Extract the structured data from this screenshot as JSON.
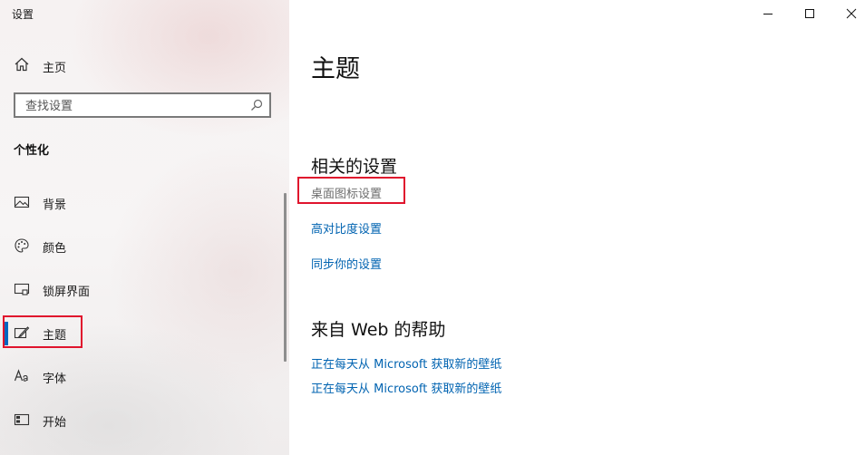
{
  "window": {
    "title": "设置",
    "minimize_icon": "minimize-icon",
    "maximize_icon": "maximize-icon",
    "close_icon": "close-icon"
  },
  "sidebar": {
    "home": {
      "label": "主页",
      "icon": "home-icon"
    },
    "search": {
      "placeholder": "查找设置",
      "value": "",
      "icon": "search-icon"
    },
    "section_title": "个性化",
    "items": [
      {
        "label": "背景",
        "icon": "picture-icon",
        "selected": false
      },
      {
        "label": "颜色",
        "icon": "palette-icon",
        "selected": false
      },
      {
        "label": "锁屏界面",
        "icon": "lock-screen-icon",
        "selected": false
      },
      {
        "label": "主题",
        "icon": "theme-brush-icon",
        "selected": true
      },
      {
        "label": "字体",
        "icon": "font-icon",
        "selected": false
      },
      {
        "label": "开始",
        "icon": "start-icon",
        "selected": false
      }
    ]
  },
  "main": {
    "title": "主题",
    "related_settings": {
      "title": "相关的设置",
      "links": [
        {
          "label": "桌面图标设置",
          "state": "disabled"
        },
        {
          "label": "高对比度设置",
          "state": "normal"
        },
        {
          "label": "同步你的设置",
          "state": "normal"
        }
      ]
    },
    "web_help": {
      "title": "来自 Web 的帮助",
      "links": [
        {
          "label": "正在每天从 Microsoft 获取新的壁纸"
        },
        {
          "label": "正在每天从 Microsoft 获取新的壁纸"
        }
      ]
    }
  },
  "colors": {
    "accent": "#0067c0",
    "link": "#0063b1",
    "highlight_box": "#e0142d"
  }
}
